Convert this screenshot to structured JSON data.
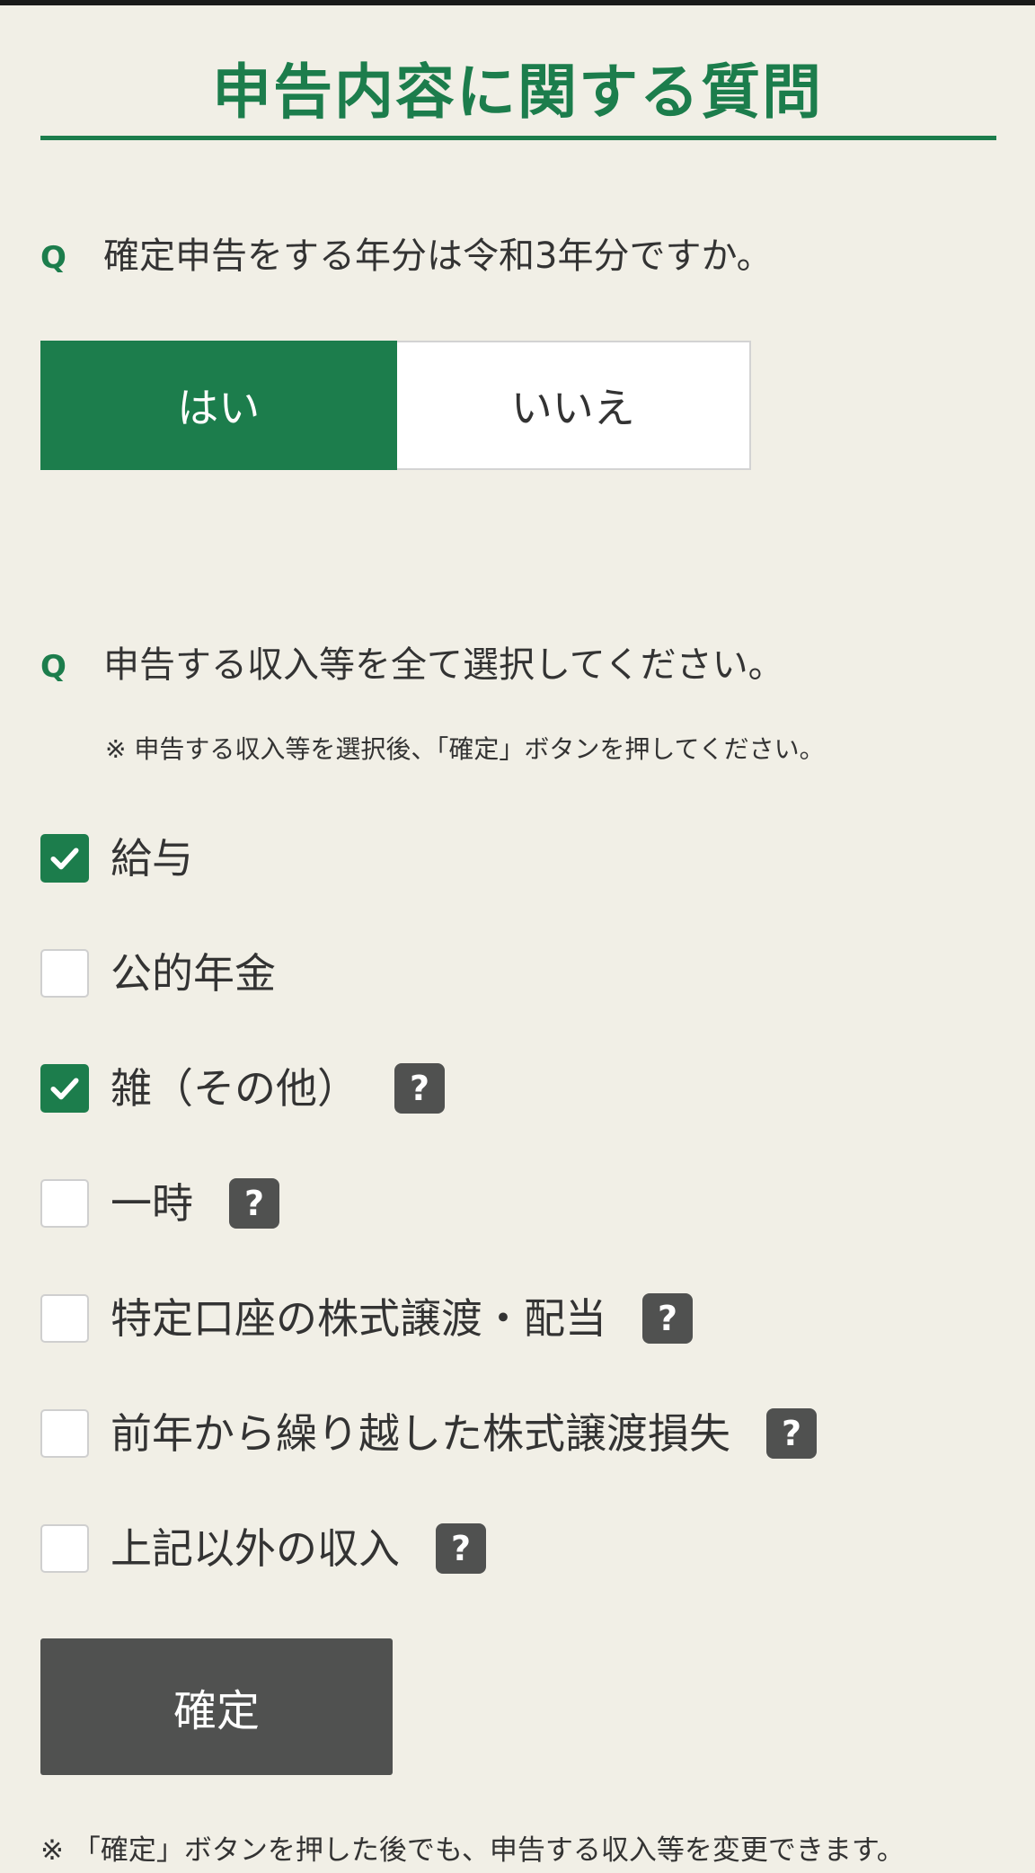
{
  "page": {
    "title": "申告内容に関する質問"
  },
  "question1": {
    "mark": "Q",
    "text": "確定申告をする年分は令和3年分ですか。",
    "options": [
      {
        "label": "はい",
        "selected": true
      },
      {
        "label": "いいえ",
        "selected": false
      }
    ]
  },
  "question2": {
    "mark": "Q",
    "text": "申告する収入等を全て選択してください。",
    "note": "※ 申告する収入等を選択後、「確定」ボタンを押してください。",
    "items": [
      {
        "label": "給与",
        "checked": true,
        "help": false
      },
      {
        "label": "公的年金",
        "checked": false,
        "help": false
      },
      {
        "label": "雑（その他）",
        "checked": true,
        "help": true
      },
      {
        "label": "一時",
        "checked": false,
        "help": true
      },
      {
        "label": "特定口座の株式譲渡・配当",
        "checked": false,
        "help": true
      },
      {
        "label": "前年から繰り越した株式譲渡損失",
        "checked": false,
        "help": true
      },
      {
        "label": "上記以外の収入",
        "checked": false,
        "help": true
      }
    ],
    "help_glyph": "?"
  },
  "confirm": {
    "label": "確定"
  },
  "footer": {
    "note": "※ 「確定」ボタンを押した後でも、申告する収入等を変更できます。"
  },
  "colors": {
    "accent": "#1c7d4c",
    "background": "#f1efe6",
    "button_dark": "#505150"
  },
  "icons": {
    "checkbox_checked": "check-icon",
    "help": "question-mark-icon"
  }
}
